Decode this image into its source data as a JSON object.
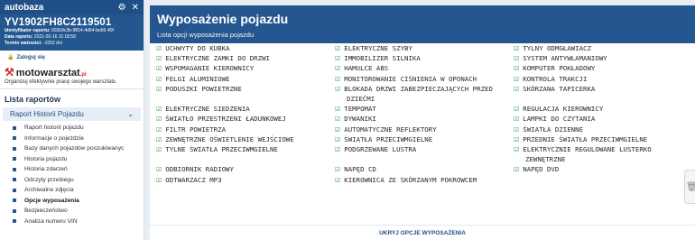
{
  "sidebar": {
    "brand": "autobaza",
    "vin": "YV1902FH8C2119501",
    "meta": [
      {
        "label": "Identyfikator raportu:",
        "value": "602b9c3b-9814-4d54-be66-40f"
      },
      {
        "label": "Data raportu:",
        "value": "2021-02-16 11:18:58"
      },
      {
        "label": "Termin ważności:",
        "value": "-1552 dni"
      }
    ],
    "login": "Zaloguj się",
    "promo_logo": "motowarsztat",
    "promo_domain": ".pl",
    "promo_text": "Organizuj efektywnie pracę swojego warsztatu",
    "section_title": "Lista raportów",
    "group_label": "Raport Historii Pojazdu",
    "items": [
      {
        "label": "Raport historii pojazdu",
        "active": false
      },
      {
        "label": "Informacje o pojeździe",
        "active": false
      },
      {
        "label": "Bazy danych pojazdów poszukiwanyc",
        "active": false
      },
      {
        "label": "Historia pojazdu",
        "active": false
      },
      {
        "label": "Historia zdarzeń",
        "active": false
      },
      {
        "label": "Odczyty przebiegu",
        "active": false
      },
      {
        "label": "Archiwalne zdjęcia",
        "active": false
      },
      {
        "label": "Opcje wyposażenia",
        "active": true
      },
      {
        "label": "Bezpieczeństwo",
        "active": false
      },
      {
        "label": "Analiza numeru VIN",
        "active": false
      }
    ]
  },
  "main": {
    "title": "Wyposażenie pojazdu",
    "subtitle": "Lista opcji wyposażenia pojazdu",
    "features": {
      "col1": [
        "UCHWYTY DO KUBKA",
        "ELEKTRYCZNE ZAMKI DO DRZWI",
        "WSPOMAGANIE KIEROWNICY",
        "FELGI ALUMINIOWE",
        "PODUSZKI POWIETRZNE",
        "",
        "ELEKTRYCZNE SIEDZENIA",
        "ŚWIATŁO PRZESTRZENI ŁADUNKOWEJ",
        "FILTR POWIETRZA",
        "ZEWNĘTRZNE OŚWIETLENIE WEJŚCIOWE",
        "TYLNE ŚWIATŁA PRZECIWMGIELNE",
        "",
        "ODBIORNIK RADIOWY",
        "ODTWARZACZ MP3"
      ],
      "col2": [
        "ELEKTRYCZNE SZYBY",
        "IMMOBILIZER SILNIKA",
        "HAMULCE ABS",
        "MONITOROWANIE CIŚNIENIA W OPONACH",
        "BLOKADA DRZWI ZABEZPIECZAJĄCYCH PRZED",
        "DZIEĆMI",
        "TEMPOMAT",
        "DYWANIKI",
        "AUTOMATYCZNE REFLEKTORY",
        "ŚWIATŁA PRZECIWMGIELNE",
        "PODGRZEWANE LUSTRA",
        "",
        "NAPĘD CD",
        "KIEROWNICA ZE SKÓRZANYM POKROWCEM"
      ],
      "col3": [
        "TYLNY ODMGŁAWIACZ",
        "SYSTEM ANTYWŁAMANIOWY",
        "KOMPUTER POKŁADOWY",
        "KONTROLA TRAKCJI",
        "SKÓRZANA TAPICERKA",
        "",
        "REGULACJA KIEROWNICY",
        "LAMPKI DO CZYTANIA",
        "ŚWIATŁA DZIENNE",
        "PRZEDNIE ŚWIATŁA PRZECIWMGIELNE",
        "ELEKTRYCZNIE REGULOWANE LUSTERKO",
        "ZEWNĘTRZNE",
        "NAPĘD DVD",
        ""
      ]
    },
    "hide_link": "UKRYJ OPCJE WYPOSAŻENIA"
  },
  "colors": {
    "primary": "#24568f",
    "check": "#2e9b4b",
    "accent_red": "#d12b2b"
  }
}
